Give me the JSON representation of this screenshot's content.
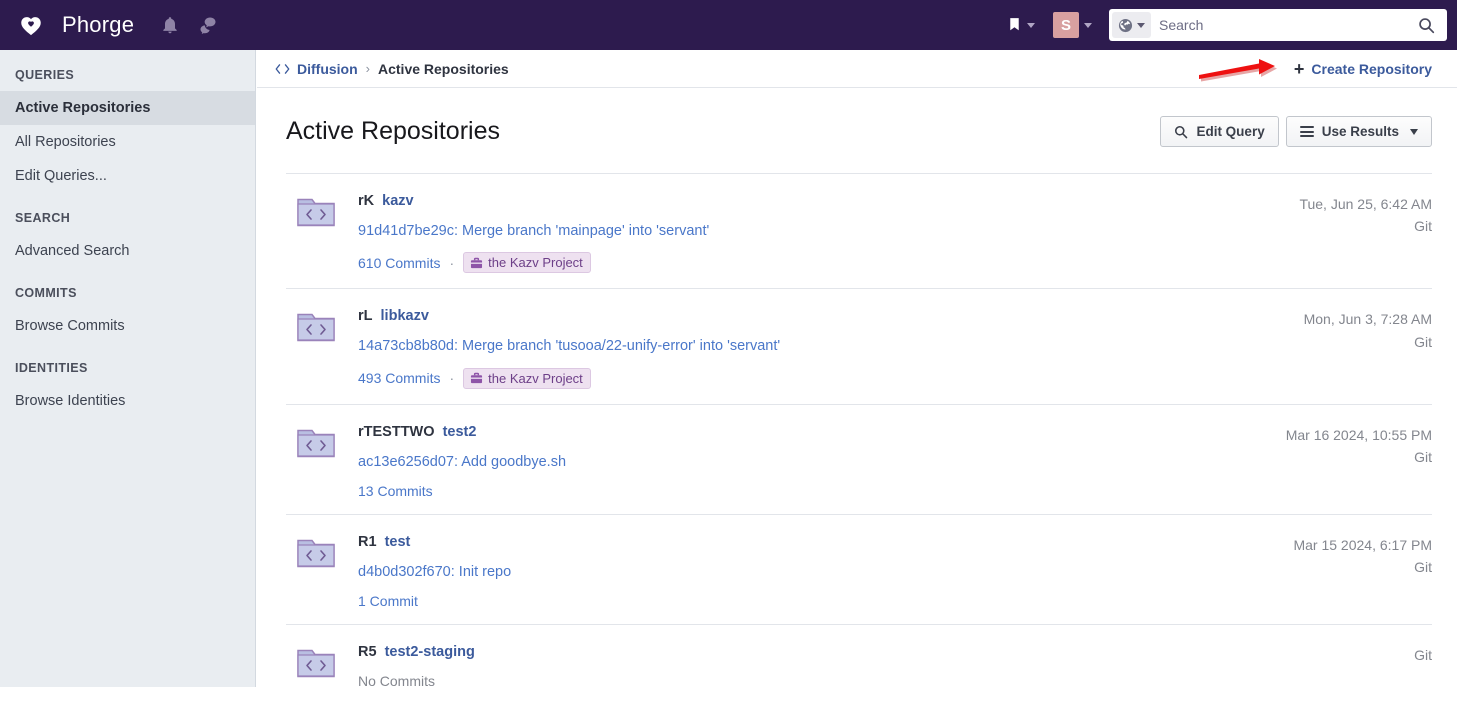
{
  "topbar": {
    "brand": "Phorge",
    "logo_icon": "heart-icon",
    "notification_icon": "bell-icon",
    "chat_icon": "chat-icon",
    "bookmark_icon": "bookmark-icon",
    "avatar_initial": "S",
    "avatar_color": "#d8a0a0",
    "background_color": "#2d1b4e",
    "search": {
      "scope_icon": "globe-icon",
      "placeholder": "Search",
      "value": "",
      "submit_icon": "search-icon"
    }
  },
  "sidebar": {
    "sections": [
      {
        "heading": "QUERIES",
        "items": [
          {
            "label": "Active Repositories",
            "active": true
          },
          {
            "label": "All Repositories",
            "active": false
          },
          {
            "label": "Edit Queries...",
            "active": false
          }
        ]
      },
      {
        "heading": "SEARCH",
        "items": [
          {
            "label": "Advanced Search",
            "active": false
          }
        ]
      },
      {
        "heading": "COMMITS",
        "items": [
          {
            "label": "Browse Commits",
            "active": false
          }
        ]
      },
      {
        "heading": "IDENTITIES",
        "items": [
          {
            "label": "Browse Identities",
            "active": false
          }
        ]
      }
    ]
  },
  "breadcrumb": {
    "app_icon": "code-icon",
    "app": "Diffusion",
    "separator": "›",
    "current": "Active Repositories",
    "create_label": "Create Repository",
    "create_icon": "plus-icon"
  },
  "main": {
    "title": "Active Repositories",
    "actions": {
      "edit_query": "Edit Query",
      "edit_query_icon": "search-icon",
      "use_results": "Use Results",
      "use_results_icon": "hamburger-icon"
    }
  },
  "repositories": [
    {
      "callsign": "rK",
      "name": "kazv",
      "commit": "91d41d7be29c: Merge branch 'mainpage' into 'servant'",
      "commit_count": "610 Commits",
      "has_count_link": true,
      "project": "the Kazv Project",
      "date": "Tue, Jun 25, 6:42 AM",
      "vcs": "Git"
    },
    {
      "callsign": "rL",
      "name": "libkazv",
      "commit": "14a73cb8b80d: Merge branch 'tusooa/22-unify-error' into 'servant'",
      "commit_count": "493 Commits",
      "has_count_link": true,
      "project": "the Kazv Project",
      "date": "Mon, Jun 3, 7:28 AM",
      "vcs": "Git"
    },
    {
      "callsign": "rTESTTWO",
      "name": "test2",
      "commit": "ac13e6256d07: Add goodbye.sh",
      "commit_count": "13 Commits",
      "has_count_link": true,
      "project": "",
      "date": "Mar 16 2024, 10:55 PM",
      "vcs": "Git"
    },
    {
      "callsign": "R1",
      "name": "test",
      "commit": "d4b0d302f670: Init repo",
      "commit_count": "1 Commit",
      "has_count_link": true,
      "project": "",
      "date": "Mar 15 2024, 6:17 PM",
      "vcs": "Git"
    },
    {
      "callsign": "R5",
      "name": "test2-staging",
      "commit": "",
      "commit_count": "No Commits",
      "has_count_link": false,
      "project": "",
      "date": "",
      "vcs": "Git"
    }
  ],
  "annotation": {
    "type": "arrow",
    "color": "#ee1111",
    "points_to": "Create Repository"
  }
}
